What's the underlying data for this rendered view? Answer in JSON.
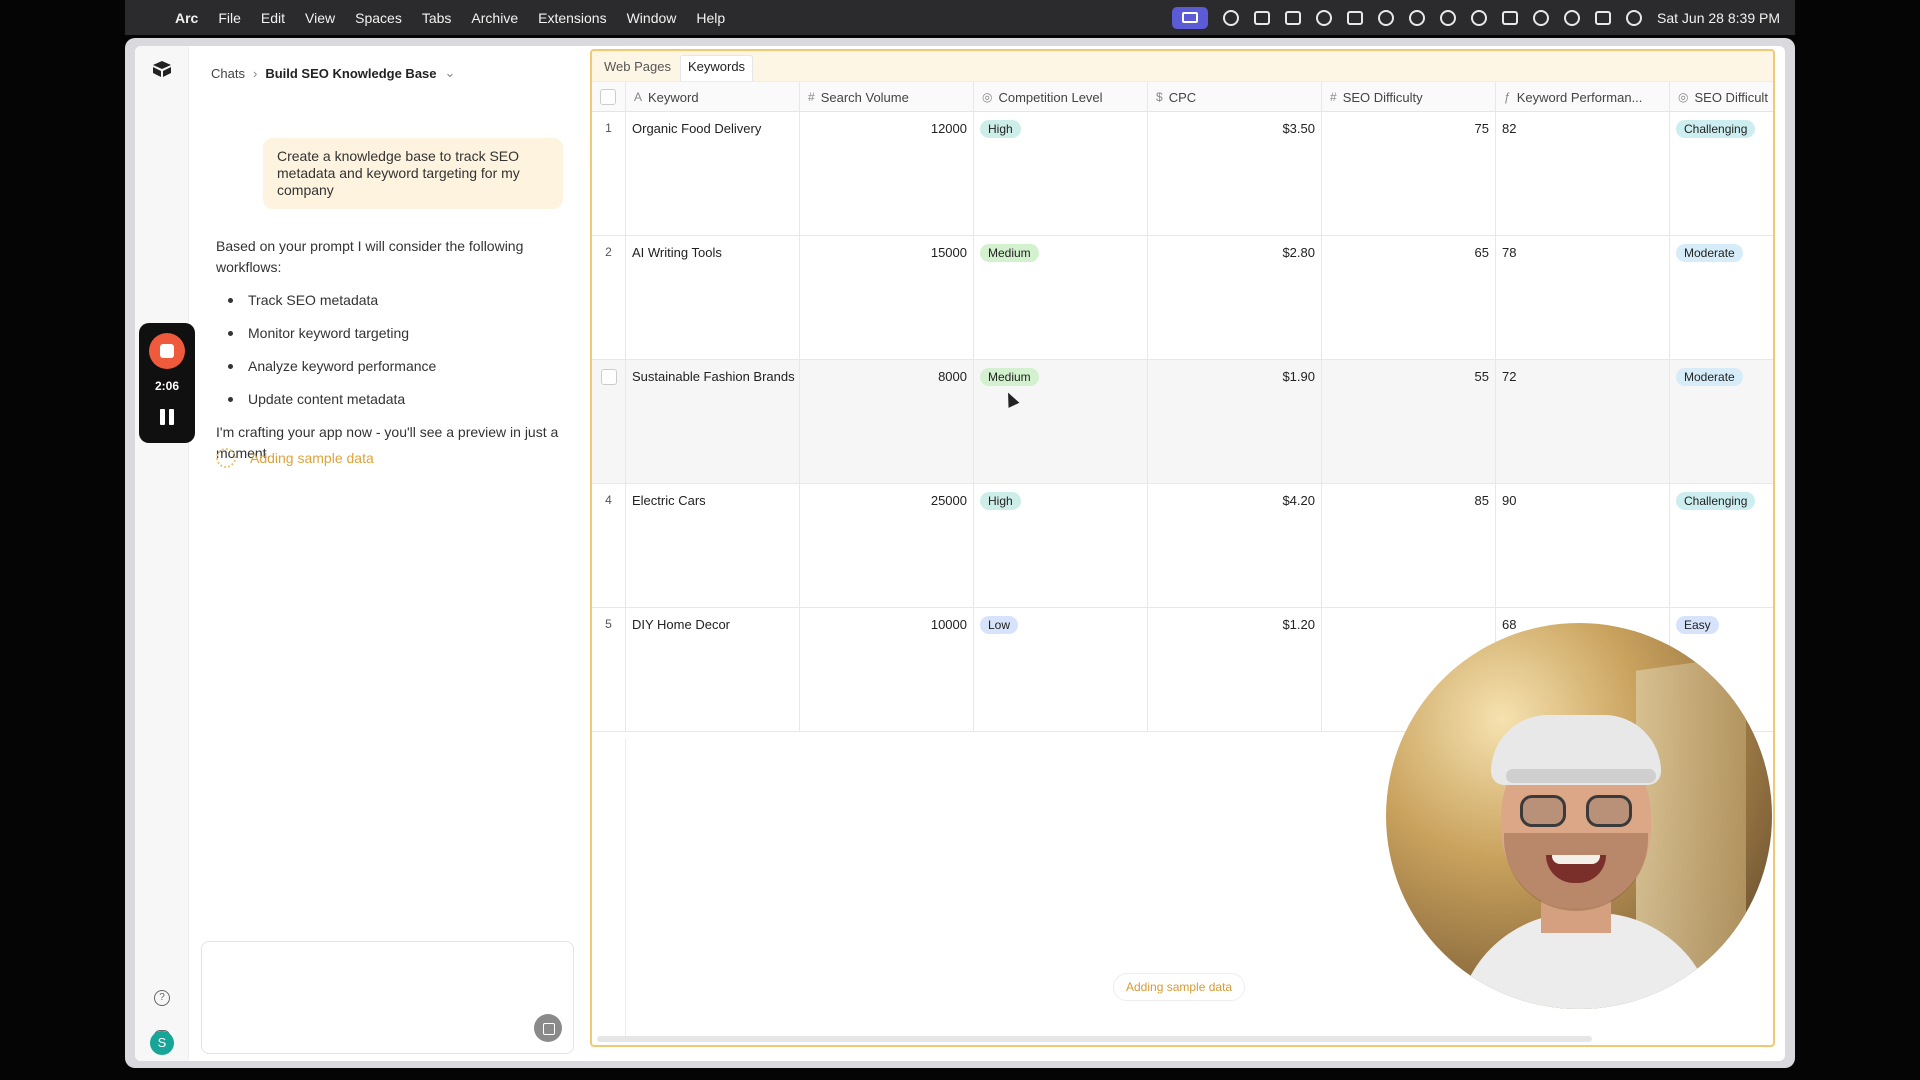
{
  "menubar": {
    "app": "Arc",
    "items": [
      "File",
      "Edit",
      "View",
      "Spaces",
      "Tabs",
      "Archive",
      "Extensions",
      "Window",
      "Help"
    ],
    "clock": "Sat Jun 28  8:39 PM"
  },
  "breadcrumb": {
    "root": "Chats",
    "current": "Build SEO Knowledge Base"
  },
  "chat": {
    "prompt": "Create a knowledge base to track SEO metadata and keyword targeting for my company",
    "reply_intro": "Based on your prompt I will consider the following workflows:",
    "workflows": [
      "Track SEO metadata",
      "Monitor keyword targeting",
      "Analyze keyword performance",
      "Update content metadata"
    ],
    "reply_outro": "I'm crafting your app now - you'll see a preview in just a moment.",
    "status": "Adding sample data"
  },
  "recorder": {
    "time": "2:06"
  },
  "tabs": [
    {
      "label": "Web Pages",
      "active": false
    },
    {
      "label": "Keywords",
      "active": true
    }
  ],
  "columns": [
    {
      "label": "Keyword",
      "icon": "A"
    },
    {
      "label": "Search Volume",
      "icon": "#"
    },
    {
      "label": "Competition Level",
      "icon": "◎"
    },
    {
      "label": "CPC",
      "icon": "$"
    },
    {
      "label": "SEO Difficulty",
      "icon": "#"
    },
    {
      "label": "Keyword Performan...",
      "icon": "ƒ"
    },
    {
      "label": "SEO Difficult",
      "icon": "◎"
    }
  ],
  "rows": [
    {
      "idx": "1",
      "keyword": "Organic Food Delivery",
      "volume": "12000",
      "competition": "High",
      "cpc": "$3.50",
      "difficulty": "75",
      "performance": "82",
      "difficulty_level": "Challenging"
    },
    {
      "idx": "2",
      "keyword": "AI Writing Tools",
      "volume": "15000",
      "competition": "Medium",
      "cpc": "$2.80",
      "difficulty": "65",
      "performance": "78",
      "difficulty_level": "Moderate"
    },
    {
      "idx": "",
      "keyword": "Sustainable Fashion Brands",
      "volume": "8000",
      "competition": "Medium",
      "cpc": "$1.90",
      "difficulty": "55",
      "performance": "72",
      "difficulty_level": "Moderate"
    },
    {
      "idx": "4",
      "keyword": "Electric Cars",
      "volume": "25000",
      "competition": "High",
      "cpc": "$4.20",
      "difficulty": "85",
      "performance": "90",
      "difficulty_level": "Challenging"
    },
    {
      "idx": "5",
      "keyword": "DIY Home Decor",
      "volume": "10000",
      "competition": "Low",
      "cpc": "$1.20",
      "difficulty": "",
      "performance": "68",
      "difficulty_level": "Easy"
    }
  ],
  "pill_colors": {
    "High": "#cdeee8",
    "Medium": "#d3f0cf",
    "Low": "#d6e3fb",
    "Challenging": "#cdeef0",
    "Moderate": "#d6ecf8",
    "Easy": "#d6e3fb"
  },
  "grid_status": "Adding sample data"
}
